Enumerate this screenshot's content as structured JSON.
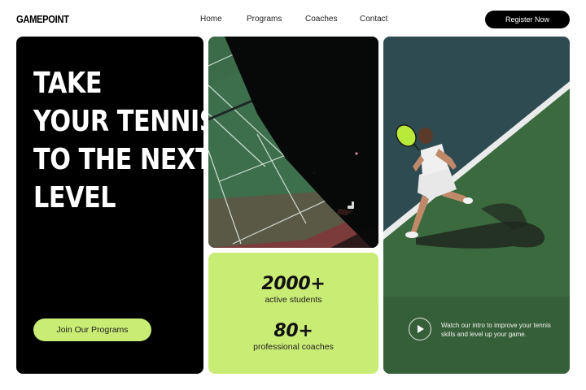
{
  "header": {
    "logo": "GAMEPOINT",
    "nav": [
      "Home",
      "Programs",
      "Coaches",
      "Contact"
    ],
    "register_label": "Register Now"
  },
  "hero": {
    "title_lines": [
      "TAKE",
      "YOUR TENNIS",
      "TO THE NEXT",
      "LEVEL"
    ],
    "cta_label": "Join Our Programs"
  },
  "stats": [
    {
      "value": "2000+",
      "label": "active students"
    },
    {
      "value": "80+",
      "label": "professional coaches"
    }
  ],
  "intro": {
    "text": "Watch our intro to improve your tennis skills and level up your game.",
    "icon": "play-icon"
  },
  "colors": {
    "accent": "#c9ec75",
    "dark": "#000000",
    "court_green": "#3a6b3e",
    "court_blue": "#2d4a50",
    "court_red": "#7a3b38"
  }
}
